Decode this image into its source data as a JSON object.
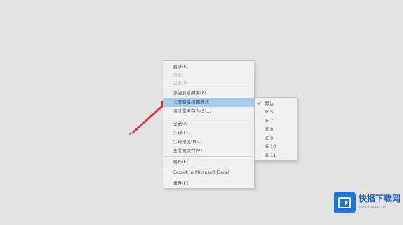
{
  "context_menu": {
    "items": [
      {
        "label": "刷新(R)",
        "state": "normal"
      },
      {
        "label": "前进",
        "state": "disabled"
      },
      {
        "label": "后退(B)",
        "state": "disabled"
      },
      {
        "label": "添加到收藏夹(F)...",
        "state": "normal"
      },
      {
        "label": "以兼容性视图模式",
        "state": "highlighted"
      },
      {
        "label": "将背景另存为(S)...",
        "state": "normal"
      },
      {
        "label": "全选(A)",
        "state": "normal"
      },
      {
        "label": "打印(I)...",
        "state": "normal"
      },
      {
        "label": "打印预览(N)...",
        "state": "normal"
      },
      {
        "label": "查看源文件(V)",
        "state": "normal"
      },
      {
        "label": "编码(E)",
        "state": "normal"
      },
      {
        "label": "Export to Microsoft Excel",
        "state": "normal"
      },
      {
        "label": "属性(P)",
        "state": "normal"
      }
    ]
  },
  "submenu": {
    "items": [
      {
        "label": "默认",
        "checked": true
      },
      {
        "label": "IE 5",
        "checked": false
      },
      {
        "label": "IE 7",
        "checked": false
      },
      {
        "label": "IE 8",
        "checked": false
      },
      {
        "label": "IE 9",
        "checked": false
      },
      {
        "label": "IE 10",
        "checked": false
      },
      {
        "label": "IE 11",
        "checked": false
      }
    ],
    "check_mark": "✓"
  },
  "watermark": {
    "name": "快播下载网",
    "url": "www.kuaibo.net"
  },
  "colors": {
    "highlight": "#a7cbf1",
    "arrow": "#d9382f",
    "logo": "#1e74da"
  }
}
